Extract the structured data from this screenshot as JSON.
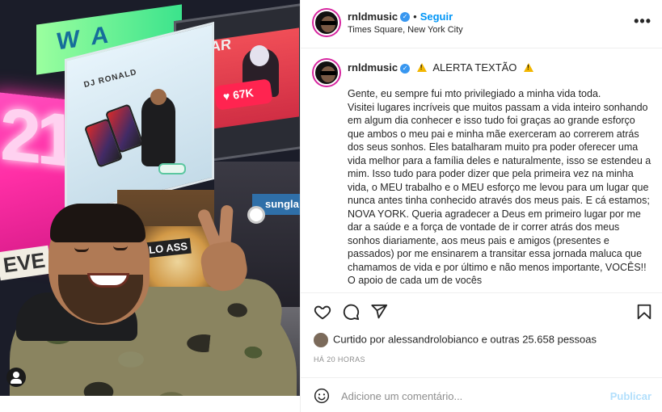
{
  "post": {
    "username": "rnldmusic",
    "follow_label": "Seguir",
    "dot": "•",
    "location": "Times Square, New York City",
    "more_label": "•••"
  },
  "photo": {
    "sign_number": "21",
    "sign_letters": "WA",
    "dj_title": "DJ RONALD",
    "share_title": "SHAR",
    "share_badge": "♥ 67K",
    "sunglass_label": "sungla",
    "solo_label": "OLO ASS",
    "levels_label": "EVE"
  },
  "caption": {
    "username": "rnldmusic",
    "title": "ALERTA TEXTÃO",
    "body": "Gente, eu sempre fui mto privilegiado a minha vida toda.\nVisitei lugares incríveis que muitos passam a vida inteiro sonhando em algum dia conhecer e isso tudo foi graças ao grande esforço que ambos o meu pai e minha mãe exerceram ao correrem atrás dos seus sonhos. Eles batalharam muito pra poder oferecer uma vida melhor para a família deles e naturalmente, isso se estendeu a mim. Isso tudo para poder dizer que pela primeira vez na minha vida, o MEU trabalho e o MEU esforço me levou para um lugar que nunca antes tinha conhecido através dos meus pais. E cá estamos; NOVA YORK. Queria agradecer a Deus em primeiro lugar por me dar a saúde e a força de vontade de ir correr atrás dos meus sonhos diariamente, aos meus pais e amigos (presentes e passados) por me ensinarem a transitar essa jornada maluca que chamamos de vida e por último e não menos importante, VOCÊS!! O apoio de cada um de vocês"
  },
  "engagement": {
    "likes_prefix": "Curtido por",
    "liked_by": "alessandrolobianco",
    "likes_suffix": "e outras",
    "likes_count": "25.658",
    "likes_unit": "pessoas",
    "time": "HÁ 20 HORAS"
  },
  "comment": {
    "placeholder": "Adicione um comentário...",
    "post_label": "Publicar"
  },
  "icons": {
    "like": "heart-icon",
    "comment": "comment-icon",
    "share": "paper-plane-icon",
    "save": "bookmark-icon",
    "emoji": "emoji-icon",
    "verified": "verified-badge-icon",
    "warning": "warning-icon",
    "user_tag": "user-tag-icon"
  },
  "colors": {
    "accent": "#0095f6",
    "verified": "#3897f0",
    "post_disabled": "#b2dffc",
    "story_ring": "#d6249f"
  }
}
